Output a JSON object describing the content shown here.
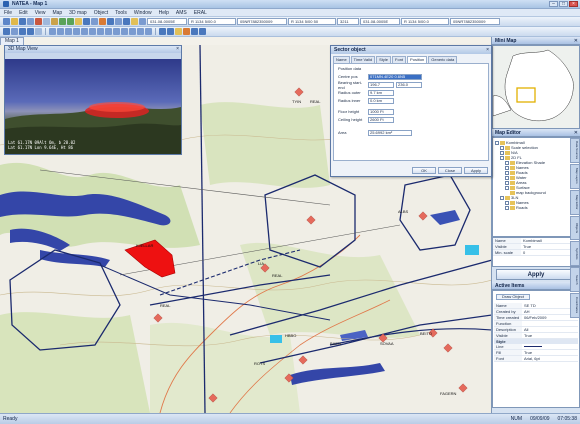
{
  "window": {
    "title": "NATEA - Map 1",
    "min": "–",
    "max": "□",
    "close": "×"
  },
  "menu": [
    "File",
    "Edit",
    "View",
    "Map",
    "3D map",
    "Object",
    "Tools",
    "Window",
    "Help",
    "AMS",
    "ERAL"
  ],
  "coords": [
    "031.08-0005E",
    "R 1134 5/00.0",
    "05NR7882350009",
    "R 1134 5/00 50",
    "3211",
    "031.08-0005E",
    "R 1134 5/00.0",
    "05NR7882350009"
  ],
  "map_tab": "Map 1",
  "view3d": {
    "title": "3D Map View",
    "cam_lines": [
      "Lat 61.17N 09Alt Om, b 28.02",
      "Lat 61.17N Lon 9.64E, Ht 86"
    ]
  },
  "dialog": {
    "title": "Sector object",
    "tabs": [
      "Name",
      "Time Valid",
      "Style",
      "Font",
      "Position",
      "Generic data"
    ],
    "active_tab_index": 4,
    "section": "Position data",
    "fields": [
      {
        "label": "Centre pos",
        "value": "071MN.4E20 0.6N5"
      },
      {
        "label": "Bearing start-end",
        "value": "196.7",
        "value2": "236.0"
      },
      {
        "label": "Radius outer",
        "value": "9.7 km"
      },
      {
        "label": "Radius inner",
        "value": "0.0 km"
      },
      {
        "label": "Floor height",
        "value": "1000 Ft"
      },
      {
        "label": "Ceiling height",
        "value": "2600 Ft"
      },
      {
        "label": "Area",
        "value": "25.6992 km²"
      }
    ],
    "buttons": [
      "OK",
      "Close",
      "Apply"
    ]
  },
  "overview": {
    "title": "Mini Map"
  },
  "editor": {
    "title": "Map Editor",
    "tree": [
      {
        "depth": 0,
        "label": "Kombimall"
      },
      {
        "depth": 1,
        "label": "Scale selection"
      },
      {
        "depth": 1,
        "label": "N/A"
      },
      {
        "depth": 1,
        "label": "2D FL"
      },
      {
        "depth": 2,
        "label": "Elevation Shade"
      },
      {
        "depth": 2,
        "label": "Names"
      },
      {
        "depth": 2,
        "label": "Roads"
      },
      {
        "depth": 2,
        "label": "Water"
      },
      {
        "depth": 2,
        "label": "Areas"
      },
      {
        "depth": 2,
        "label": "Surface"
      },
      {
        "depth": 3,
        "label": "map background"
      },
      {
        "depth": 1,
        "label": "3LN"
      },
      {
        "depth": 2,
        "label": "Names"
      },
      {
        "depth": 2,
        "label": "Roads"
      }
    ],
    "props": [
      {
        "k": "Name",
        "v": "Kombimall"
      },
      {
        "k": "Visible",
        "v": "True"
      },
      {
        "k": "Min. scale",
        "v": "0"
      }
    ],
    "apply": "Apply"
  },
  "active_items": {
    "title": "Active Items",
    "button": "Draw Object",
    "rows": [
      {
        "k": "Name",
        "v": "SE TD"
      },
      {
        "k": "Created by",
        "v": "AH"
      },
      {
        "k": "Time created",
        "v": "06/Feb/2009"
      },
      {
        "k": "Function",
        "v": ""
      },
      {
        "k": "Description",
        "v": "All"
      },
      {
        "k": "Visible",
        "v": "True"
      }
    ],
    "style_section": "Style",
    "style_rows": [
      {
        "k": "Line",
        "v": ""
      },
      {
        "k": "Fill",
        "v": "True"
      },
      {
        "k": "Font",
        "v": "Arial, 6pt"
      }
    ]
  },
  "side_tabs": [
    "Data Sources",
    "Map Layers",
    "Map Editor",
    "Objects",
    "Symbols",
    "Search",
    "Coordinates"
  ],
  "status": {
    "left": "Ready",
    "right": [
      "NUM",
      "09/09/09",
      "07:05:38"
    ]
  },
  "map_labels": [
    "KJELLAR",
    "TYIN",
    "REAL",
    "ALBS",
    "LIA",
    "HBBO",
    "REAL",
    "SOVAA",
    "BEITO",
    "BAEN",
    "ROTS",
    "FAGERN",
    "REAL"
  ],
  "colors": {
    "red_sector": "#ee1111",
    "airspace": "#1b2a6e",
    "water": "#2e3fa6",
    "marker": "#e56a5c"
  }
}
